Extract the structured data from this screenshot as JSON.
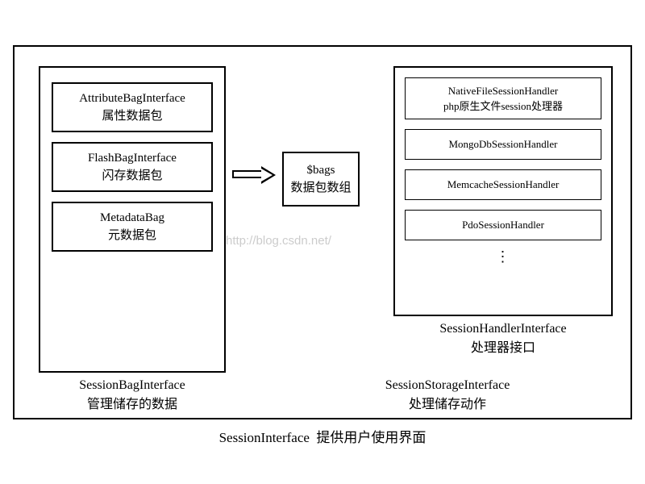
{
  "outer": {
    "caption_interface": "SessionInterface",
    "caption_desc": "提供用户使用界面"
  },
  "sessionBag": {
    "caption_interface": "SessionBagInterface",
    "caption_desc": "管理储存的数据",
    "items": [
      {
        "name": "AttributeBagInterface",
        "desc": "属性数据包"
      },
      {
        "name": "FlashBagInterface",
        "desc": "闪存数据包"
      },
      {
        "name": "MetadataBag",
        "desc": "元数据包"
      }
    ]
  },
  "bags": {
    "var": "$bags",
    "desc": "数据包数组"
  },
  "storage": {
    "caption_interface": "SessionStorageInterface",
    "caption_desc": "处理储存动作"
  },
  "handler": {
    "caption_interface": "SessionHandlerInterface",
    "caption_desc": "处理器接口",
    "items": [
      {
        "name": "NativeFileSessionHandler",
        "desc": "php原生文件session处理器"
      },
      {
        "name": "MongoDbSessionHandler",
        "desc": ""
      },
      {
        "name": "MemcacheSessionHandler",
        "desc": ""
      },
      {
        "name": "PdoSessionHandler",
        "desc": ""
      }
    ],
    "ellipsis": "⋮"
  },
  "watermark": "http://blog.csdn.net/"
}
